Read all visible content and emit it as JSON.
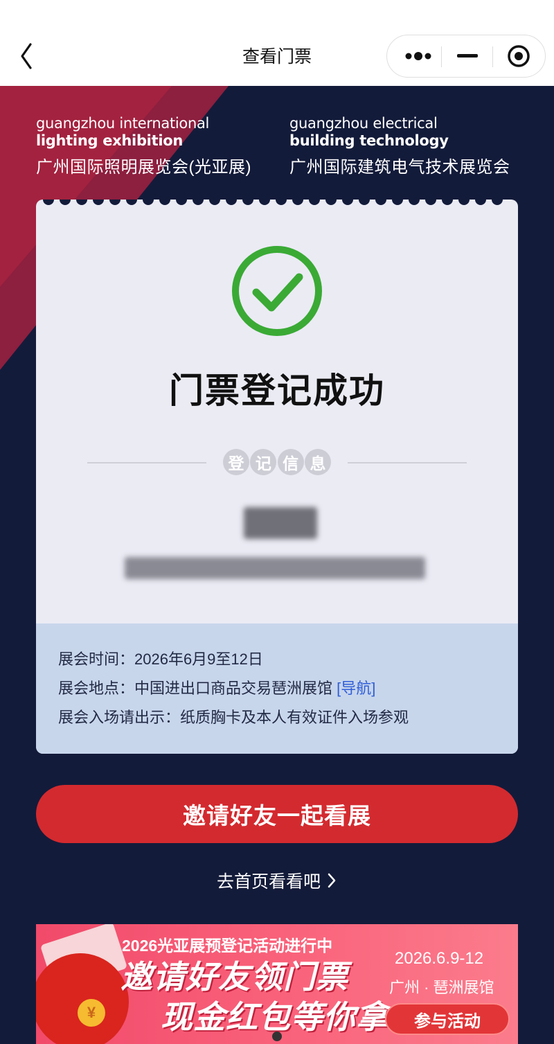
{
  "navbar": {
    "title": "查看门票",
    "icons": [
      "back-arrow-icon",
      "more-dots-icon",
      "minimize-icon",
      "close-target-icon"
    ]
  },
  "header": {
    "left_en_line1": "guangzhou international",
    "left_en_line2": "lighting exhibition",
    "left_cn": "广州国际照明展览会(光亚展)",
    "right_en_line1": "guangzhou electrical",
    "right_en_line2": "building technology",
    "right_cn": "广州国际建筑电气技术展览会"
  },
  "ticket": {
    "status_title": "门票登记成功",
    "section_label": [
      "登",
      "记",
      "信",
      "息"
    ],
    "info": {
      "time": "展会时间：2026年6月9至12日",
      "place": "展会地点：中国进出口商品交易琶洲展馆",
      "nav_label": "[导航]",
      "entry": "展会入场请出示：纸质胸卡及本人有效证件入场参观"
    }
  },
  "actions": {
    "invite_label": "邀请好友一起看展",
    "home_label": "去首页看看吧"
  },
  "banner": {
    "line1": "2026光亚展预登记活动进行中",
    "line2": "邀请好友领门票",
    "line3": "现金红包等你拿",
    "date": "2026.6.9-12",
    "venue": "广州 · 琶洲展馆",
    "cta": "参与活动",
    "coin": "¥"
  },
  "colors": {
    "background": "#131b3a",
    "accent_red": "#d32a2f",
    "success_green": "#3aaa35",
    "link_blue": "#2f5ed7"
  }
}
